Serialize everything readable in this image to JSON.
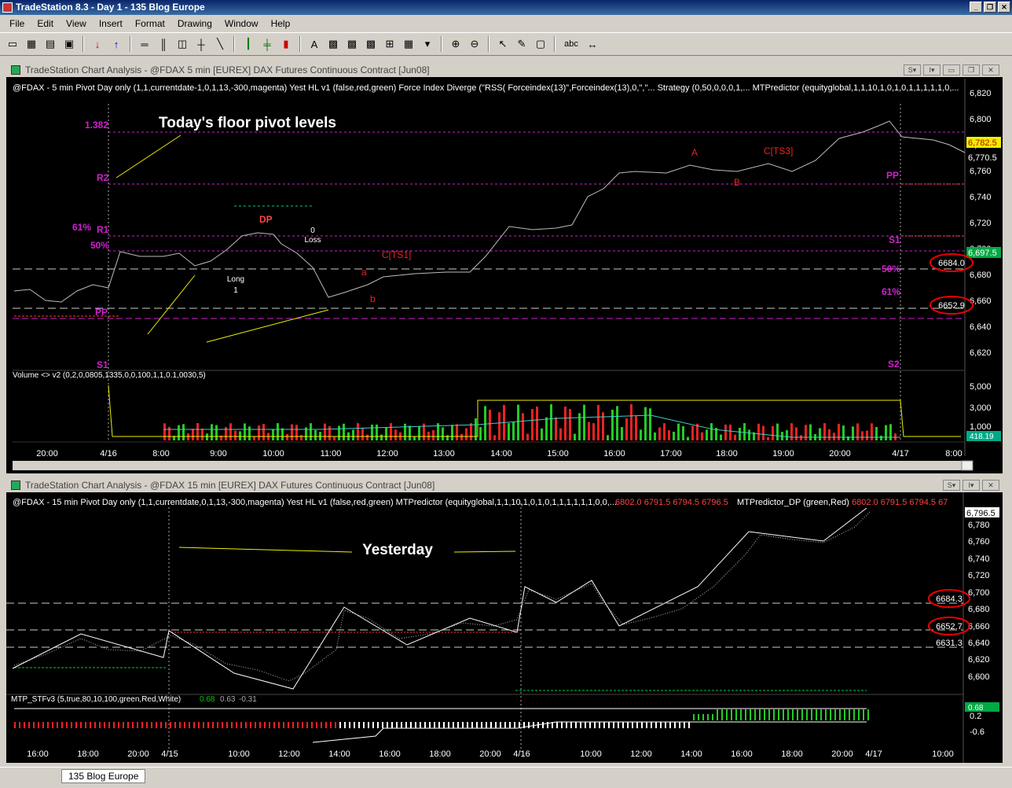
{
  "app": {
    "title": "TradeStation 8.3 - Day 1 - 135 Blog Europe"
  },
  "menu": [
    "File",
    "Edit",
    "View",
    "Insert",
    "Format",
    "Drawing",
    "Window",
    "Help"
  ],
  "toolbar": {
    "text_tool": "abc"
  },
  "top_chart": {
    "window_title": "TradeStation Chart Analysis - @FDAX  5 min  [EUREX] DAX  Futures Continuous Contract [Jun08]",
    "indicators_line": "@FDAX - 5 min  Pivot Day only (1,1,currentdate-1,0,1,13,-300,magenta)   Yest HL v1 (false,red,green)   Force Index Diverge (\"RSS( Forceindex(13)\",Forceindex(13),0,\",\"...   Strategy (0,50,0,0,0,1,...   MTPredictor (equityglobal,1,1,10,1,0,1,0,1,1,1,1,1,0,...",
    "annotation": "Today's floor pivot levels",
    "pivot_labels": {
      "left": [
        "1.382",
        "R2",
        "61%",
        "R1",
        "50%",
        "PP",
        "S1"
      ],
      "right": [
        "PP",
        "S1",
        "50%",
        "61%",
        "S2"
      ]
    },
    "trade_labels": {
      "dp": "DP",
      "long": "Long",
      "one": "1",
      "zero": "0",
      "loss": "Loss",
      "cts1": "C[TS1]",
      "a_small": "a",
      "b_small": "b",
      "A": "A",
      "B": "B",
      "cts3": "C[TS3]"
    },
    "price_axis": [
      "6,820",
      "6,800",
      "6,780",
      "6,760",
      "6,740",
      "6,720",
      "6,700",
      "6,680",
      "6,660",
      "6,640",
      "6,620"
    ],
    "price_tags": {
      "last": "6,782.5",
      "hl": "6,770.5",
      "green": "6,697.5",
      "circle1": "6684.0",
      "circle2": "6652.9"
    },
    "volume_label": "Volume <> v2 (0,2,0,0805,1335,0,0,100,1,1,0.1,0030,5)",
    "volume_axis": [
      "5,000",
      "3,000",
      "1,000"
    ],
    "volume_tag": "418.19",
    "time_axis": [
      "20:00",
      "4/16",
      "8:00",
      "9:00",
      "10:00",
      "11:00",
      "12:00",
      "13:00",
      "14:00",
      "15:00",
      "16:00",
      "17:00",
      "18:00",
      "19:00",
      "20:00",
      "4/17",
      "8:00"
    ]
  },
  "bottom_chart": {
    "window_title": "TradeStation Chart Analysis - @FDAX  15 min  [EUREX] DAX  Futures Continuous Contract [Jun08]",
    "indicators_line": "@FDAX - 15 min  Pivot Day only (1,1,currentdate,0,1,13,-300,magenta)   Yest HL v1 (false,red,green)   MTPredictor (equityglobal,1,1,10,1,0,1,0,1,1,1,1,1,1,0,0,...",
    "ohlc_values": "6802.0  6791.5  6794.5  6796.5",
    "mtp_dp": "MTPredictor_DP (green,Red)",
    "ohlc_values2": "6802.0  6791.5  6794.5  67",
    "annotation": "Yesterday",
    "price_axis": [
      "6,780",
      "6,760",
      "6,740",
      "6,720",
      "6,700",
      "6,680",
      "6,660",
      "6,640",
      "6,620",
      "6,600"
    ],
    "price_tags": {
      "last": "6,796.5",
      "c1": "6684.3",
      "c2": "6652.7",
      "plain": "6631.3"
    },
    "osc_label": "MTP_STFv3 (5,true,80,10,100,green,Red,White)",
    "osc_values": [
      "0.68",
      "0.63",
      "-0.31"
    ],
    "osc_axis": [
      "0.2",
      "-0.6"
    ],
    "osc_tag": "0.68",
    "time_axis": [
      "16:00",
      "18:00",
      "20:00",
      "4/15",
      "10:00",
      "12:00",
      "14:00",
      "16:00",
      "18:00",
      "20:00",
      "4/16",
      "10:00",
      "12:00",
      "14:00",
      "16:00",
      "18:00",
      "20:00",
      "4/17",
      "10:00"
    ]
  },
  "taskbar": {
    "tab": "135 Blog Europe"
  }
}
